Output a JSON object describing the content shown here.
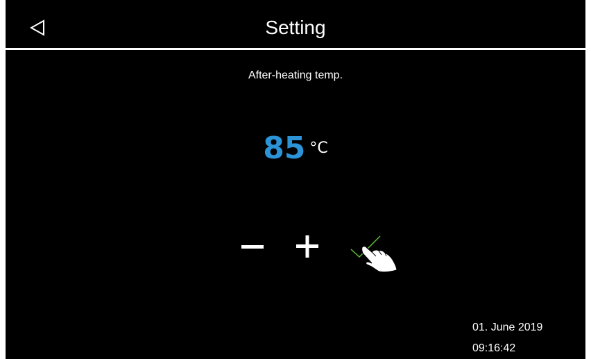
{
  "header": {
    "title": "Setting",
    "back_icon": "back-triangle-icon"
  },
  "parameter": {
    "label": "After-heating temp.",
    "value": "85",
    "unit": "°C",
    "value_color": "#2b93d6"
  },
  "controls": {
    "minus_icon": "minus-icon",
    "plus_icon": "plus-icon",
    "confirm_icon": "checkmark-icon",
    "pointer_icon": "hand-pointer-icon",
    "confirm_color": "#5fbf3a"
  },
  "status": {
    "date": "01. June 2019",
    "time": "09:16:42"
  }
}
